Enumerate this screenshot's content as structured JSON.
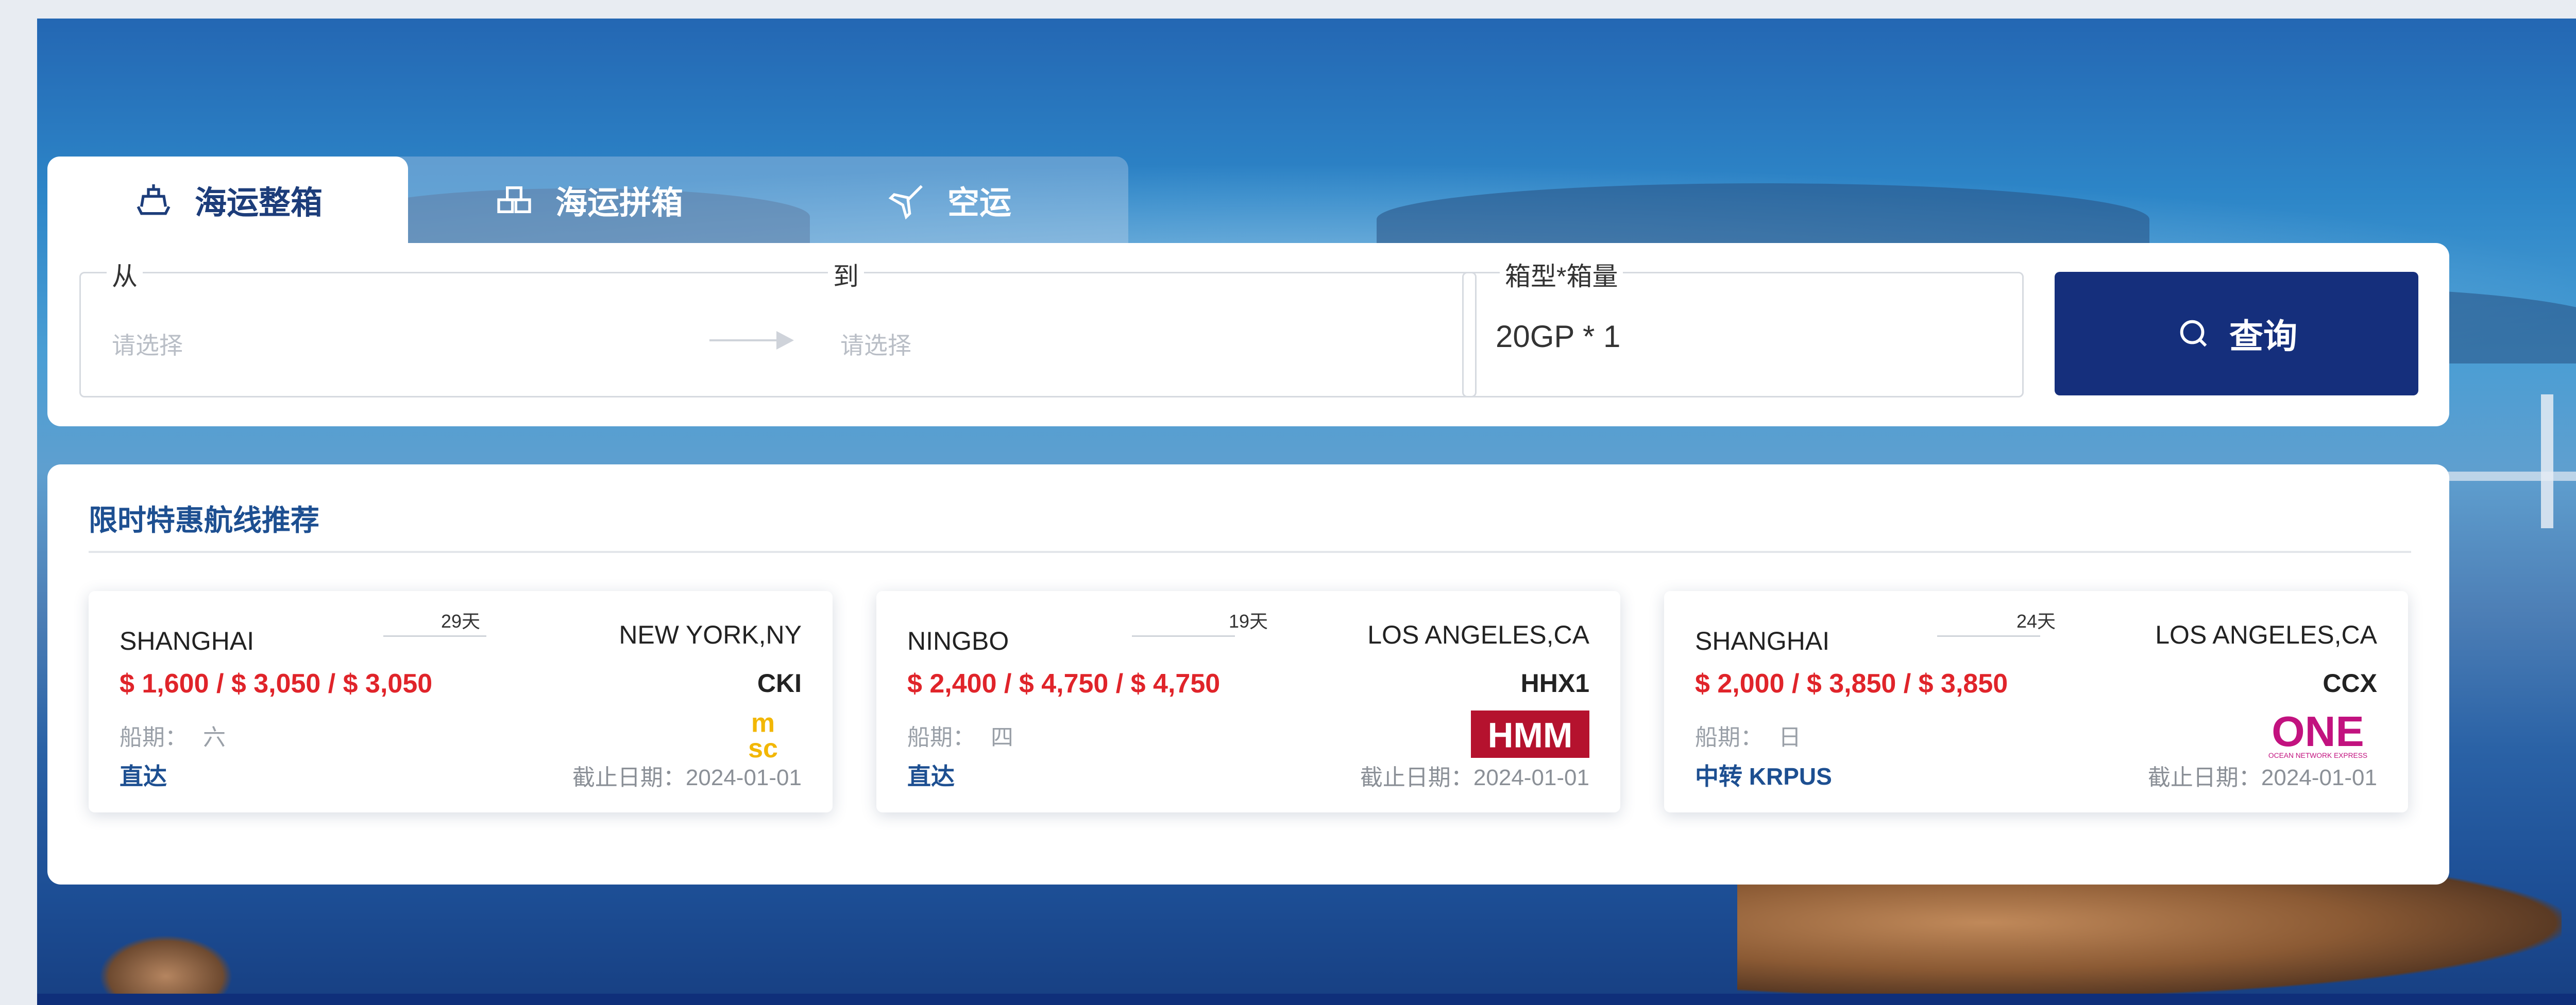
{
  "tabs": [
    {
      "label": "海运整箱",
      "icon": "ship-icon",
      "active": true
    },
    {
      "label": "海运拼箱",
      "icon": "boxes-icon",
      "active": false
    },
    {
      "label": "空运",
      "icon": "plane-icon",
      "active": false
    }
  ],
  "search": {
    "from_label": "从",
    "from_placeholder": "请选择",
    "to_label": "到",
    "to_placeholder": "请选择",
    "box_label": "箱型*箱量",
    "box_value": "20GP * 1",
    "button_label": "查询"
  },
  "promo": {
    "title": "限时特惠航线推荐",
    "cards": [
      {
        "pol": "SHANGHAI",
        "pod": "NEW YORK,NY",
        "days": "29天",
        "price": "$ 1,600 / $ 3,050 / $ 3,050",
        "service": "CKI",
        "schedule_label": "船期：",
        "schedule_value": "六",
        "transit": "直达",
        "cutoff": "截止日期：2024-01-01",
        "carrier_logo": "MSC"
      },
      {
        "pol": "NINGBO",
        "pod": "LOS ANGELES,CA",
        "days": "19天",
        "price": "$ 2,400 / $ 4,750 / $ 4,750",
        "service": "HHX1",
        "schedule_label": "船期：",
        "schedule_value": "四",
        "transit": "直达",
        "cutoff": "截止日期：2024-01-01",
        "carrier_logo": "HMM"
      },
      {
        "pol": "SHANGHAI",
        "pod": "LOS ANGELES,CA",
        "days": "24天",
        "price": "$ 2,000 / $ 3,850 / $ 3,850",
        "service": "CCX",
        "schedule_label": "船期：",
        "schedule_value": "日",
        "transit": "中转 KRPUS",
        "cutoff": "截止日期：2024-01-01",
        "carrier_logo": "ONE"
      }
    ]
  },
  "colors": {
    "primary": "#152f7c",
    "price": "#e0242a",
    "title": "#1d4f91"
  }
}
